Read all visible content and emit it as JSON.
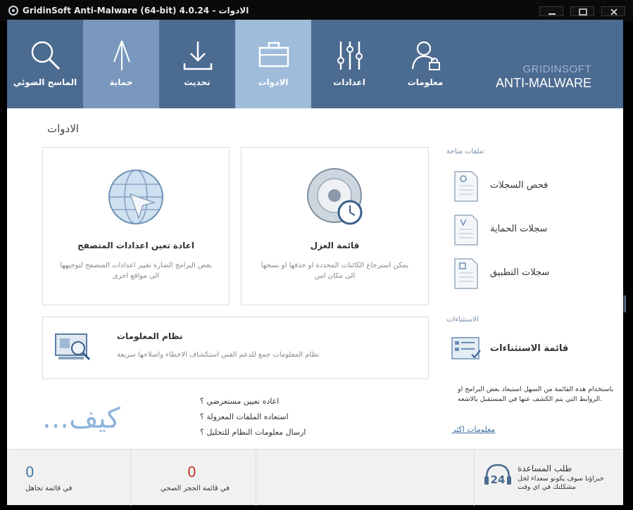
{
  "window": {
    "title": "GridinSoft Anti-Malware (64-bit) 4.0.24 - الادوات"
  },
  "nav": {
    "items": [
      {
        "label": "الماسح الضوئي",
        "icon": "magnifier-icon"
      },
      {
        "label": "حماية",
        "icon": "shield-arrow-icon"
      },
      {
        "label": "تحديث",
        "icon": "download-icon"
      },
      {
        "label": "الادوات",
        "icon": "toolbox-icon"
      },
      {
        "label": "اعدادات",
        "icon": "sliders-icon"
      },
      {
        "label": "معلومات",
        "icon": "user-lock-icon"
      }
    ],
    "brand_line1": "GRIDINSOFT",
    "brand_line2": "ANTI-MALWARE"
  },
  "page": {
    "title": "الادوات"
  },
  "cards": {
    "browser_reset": {
      "title": "اعادة تعين اعدادات المتصفح",
      "desc": "بعض البرامج الضارة تغيير اعدادات المتصفح لتوجيهها الى مواقع اخرى"
    },
    "quarantine": {
      "title": "قائمة العزل",
      "desc": "يمكن استرجاع الكائنات المحددة او حذفها او نسخها الى مكان امن"
    },
    "system_info": {
      "title": "نظام المعلومات",
      "desc": "نظام المعلومات جمع للدعم الفني استكشاف الاخطاء واصلاحها سريعة"
    }
  },
  "available_files": {
    "heading": "ملفات متاحة:",
    "items": [
      {
        "label": "فحص السجلات"
      },
      {
        "label": "سجلات الحماية"
      },
      {
        "label": "سجلات التطبيق"
      }
    ]
  },
  "exceptions": {
    "heading": "الاستثناءات",
    "item_label": "قائمة الاستثناءات",
    "note": "باستخدام هذه القائمة من السهل استبعاد بعض البرامج او الروابط التي يتم الكشف عنها في المستقبل بالاشعه.",
    "more_link": "معلومات اكثر"
  },
  "howto": {
    "label": "...كيف",
    "questions": [
      "اعاده تعيين مستعرضي ؟",
      "استعاده الملفات المعزولة ؟",
      "ارسال معلومات النظام للتحليل ؟"
    ]
  },
  "footer": {
    "ignore_count": "0",
    "ignore_label": "في قائمة تجاهل",
    "quarantine_count": "0",
    "quarantine_label": "في قائمة الحجر الصحي",
    "help_title": "طلب المساعدة",
    "help_desc": "خبراؤنا سوف يكونو سعداء لحل مشكلتك في اي وقت",
    "help_badge": "24"
  },
  "colors": {
    "nav_bg": "#4c6b91",
    "nav_active": "#9fbcdb",
    "nav_hover": "#7a98bd",
    "quarantine_count": "#c0392b",
    "ignore_count": "#4a78a8"
  }
}
